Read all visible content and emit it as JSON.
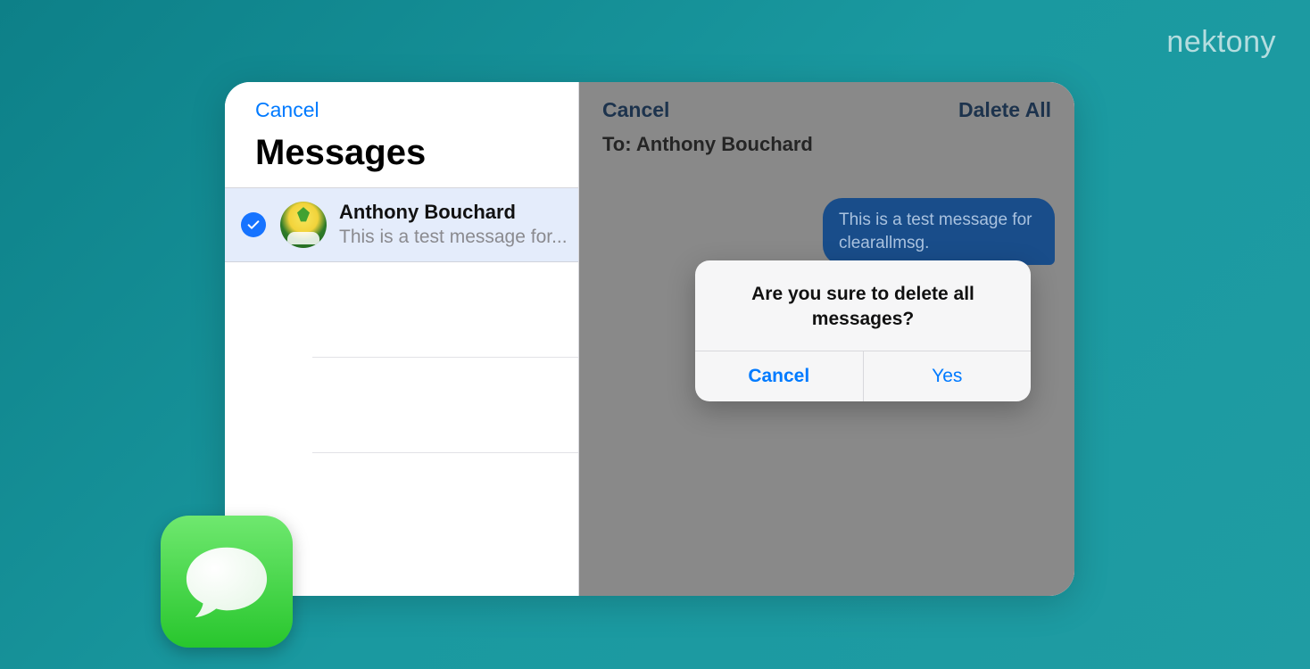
{
  "brand": "nektony",
  "left": {
    "cancel": "Cancel",
    "title": "Messages",
    "conversation": {
      "name": "Anthony Bouchard",
      "preview": "This is a test message for..."
    }
  },
  "right": {
    "cancel": "Cancel",
    "delete_all": "Dalete All",
    "to_prefix": "To: ",
    "to_name": "Anthony Bouchard",
    "bubble": "This is a test message for clearallmsg."
  },
  "alert": {
    "message": "Are you sure to delete all messages?",
    "cancel": "Cancel",
    "yes": "Yes"
  },
  "icons": {
    "check": "check-icon",
    "messages_app": "messages-app-icon"
  }
}
